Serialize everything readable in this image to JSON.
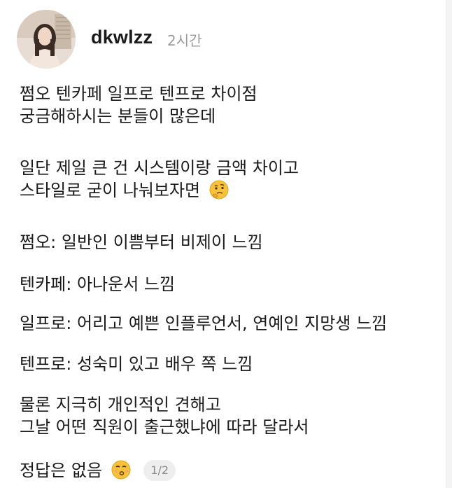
{
  "post": {
    "username": "dkwlzz",
    "timestamp": "2시간",
    "paragraphs": [
      [
        "쩜오 텐카페 일프로 텐프로 차이점",
        "궁금해하시는 분들이 많은데"
      ],
      [
        "일단 제일 큰 건 시스템이랑 금액 차이고",
        "스타일로 굳이 나눠보자면"
      ],
      [
        "쩜오: 일반인 이쁨부터 비제이 느낌"
      ],
      [
        "텐카페: 아나운서 느낌"
      ],
      [
        "일프로: 어리고 예쁜 인플루언서, 연예인 지망생 느낌"
      ],
      [
        "텐프로: 성숙미 있고 배우 쪽 느낌"
      ],
      [
        "물론 지극히 개인적인 견해고",
        "그날 어떤 직원이 출근했냐에 따라 달라서"
      ],
      [
        "정답은 없음"
      ]
    ],
    "page_indicator": "1/2",
    "icons": {
      "thinking": "thinking-face-emoji",
      "kissing": "kissing-face-emoji"
    }
  }
}
